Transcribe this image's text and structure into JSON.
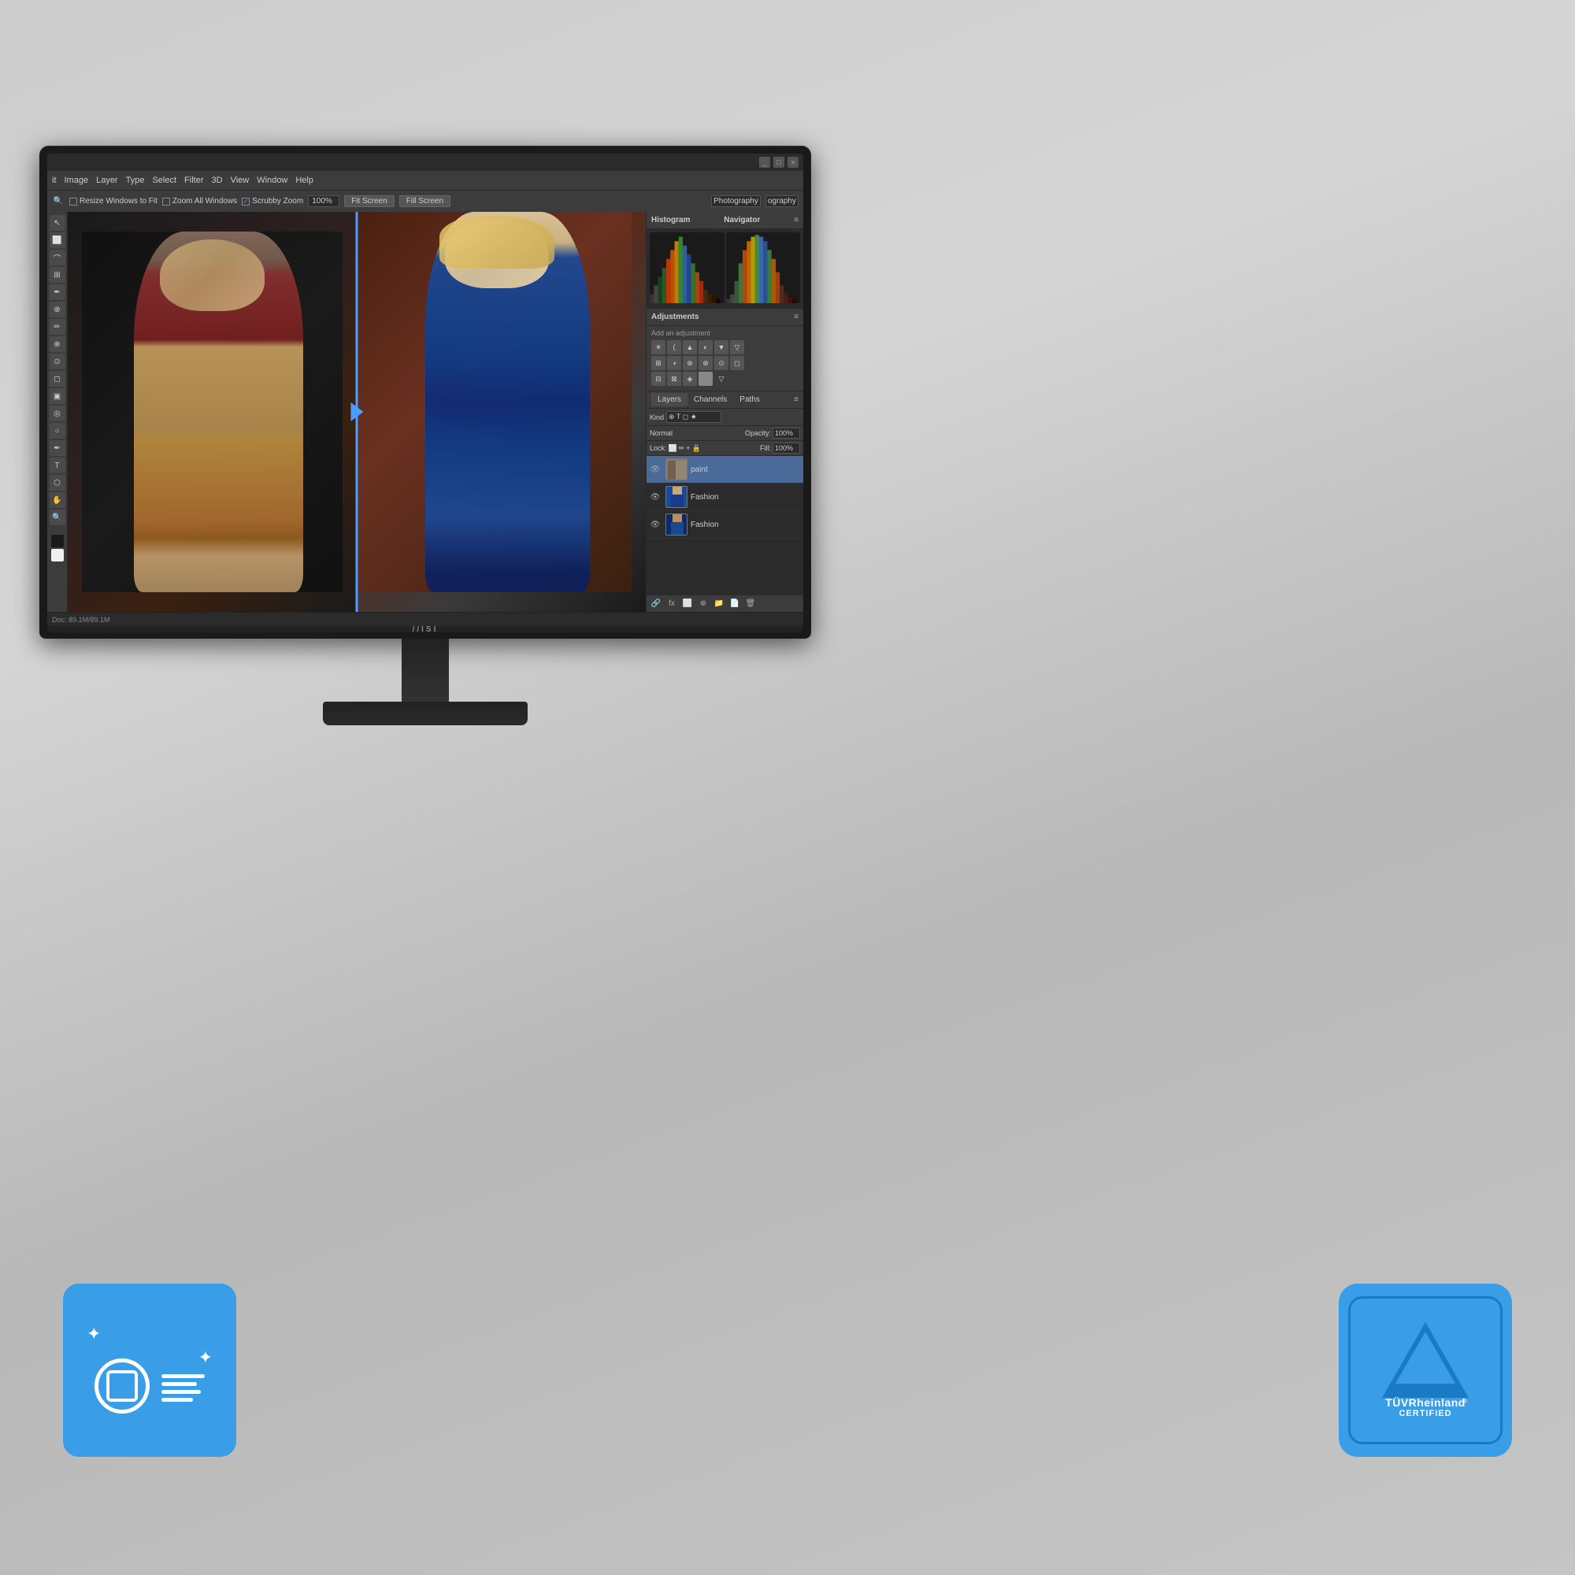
{
  "page": {
    "background": "#cccccc"
  },
  "monitor": {
    "brand": "//ISI"
  },
  "photoshop": {
    "titlebar": {
      "buttons": [
        "_",
        "□",
        "×"
      ]
    },
    "menubar": {
      "items": [
        "it",
        "Image",
        "Layer",
        "Type",
        "Select",
        "Filter",
        "3D",
        "View",
        "Window",
        "Help"
      ]
    },
    "toolbar": {
      "resize_windows_label": "Resize Windows to Fit",
      "zoom_all_label": "Zoom All Windows",
      "scrubby_zoom_label": "Scrubby Zoom",
      "zoom_percent": "100%",
      "fit_screen_label": "Fit Screen",
      "fill_screen_label": "Fill Screen",
      "workspace_label": "Photography",
      "workspace_label2": "ography"
    },
    "panels": {
      "histogram_label": "Histogram",
      "navigator_label": "Navigator",
      "adjustments_label": "Adjustments",
      "add_adjustment_label": "Add an adjustment",
      "layers_label": "Layers",
      "channels_label": "Channels",
      "paths_label": "Paths"
    },
    "layers": {
      "blend_mode": "Normal",
      "opacity_label": "Opacity:",
      "opacity_value": "100%",
      "lock_label": "Lock:",
      "fill_label": "Fill:",
      "fill_value": "100%",
      "items": [
        {
          "name": "paint",
          "type": "paint"
        },
        {
          "name": "Fashion",
          "type": "fashion1"
        },
        {
          "name": "Fashion",
          "type": "fashion2"
        }
      ]
    }
  },
  "badges": {
    "left": {
      "aria_label": "Eye Care Display Badge"
    },
    "right": {
      "brand": "TÜVRheinland",
      "registered": "®",
      "certified": "CERTIFIED"
    }
  }
}
